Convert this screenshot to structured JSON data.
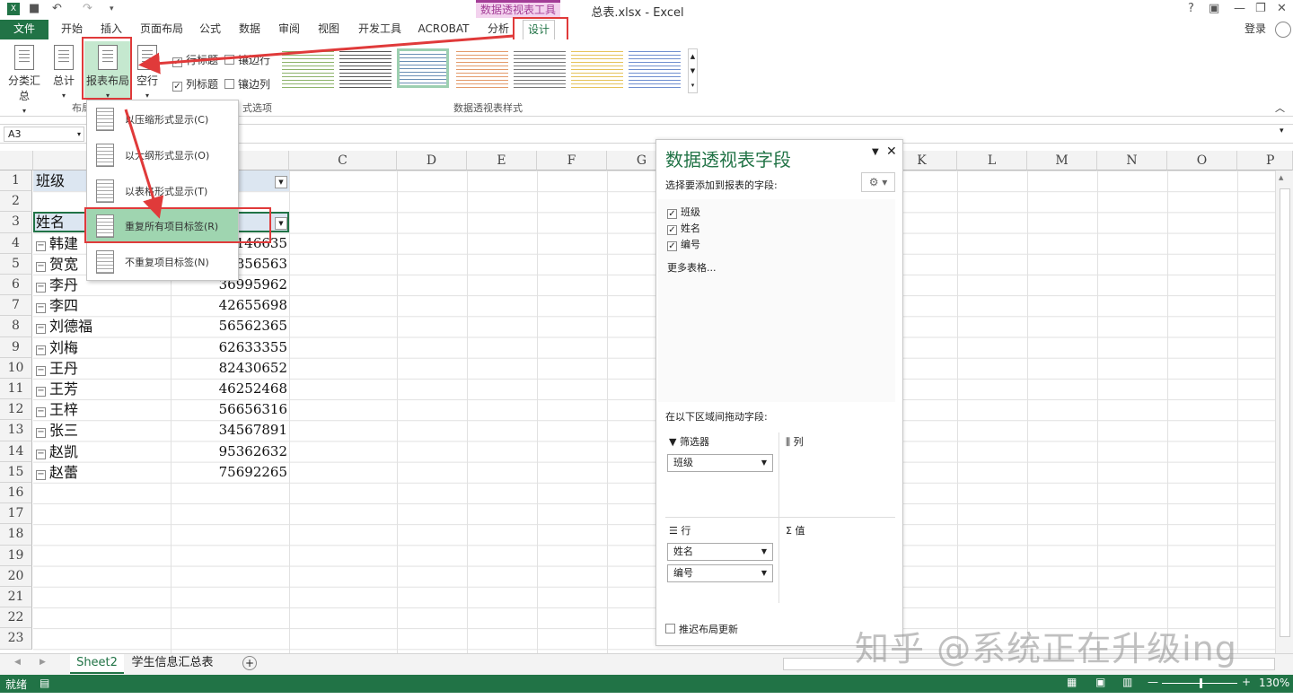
{
  "window": {
    "title": "总表.xlsx - Excel",
    "context_tool": "数据透视表工具",
    "login": "登录"
  },
  "tabs": [
    "文件",
    "开始",
    "插入",
    "页面布局",
    "公式",
    "数据",
    "审阅",
    "视图",
    "开发工具",
    "ACROBAT",
    "分析",
    "设计"
  ],
  "ribbon": {
    "subtotal": "分类汇总",
    "grandtotal": "总计",
    "report_layout": "报表布局",
    "blank_rows": "空行",
    "layout_group": "布局",
    "row_headers": "行标题",
    "banded_rows": "镶边行",
    "col_headers": "列标题",
    "banded_cols": "镶边列",
    "options_group": "数据透视表样式选项",
    "options_group_visible": "式选项",
    "styles_group": "数据透视表样式"
  },
  "formula_bar": {
    "name_box": "A3"
  },
  "dropdown": {
    "items": [
      "以压缩形式显示(C)",
      "以大纲形式显示(O)",
      "以表格形式显示(T)",
      "重复所有项目标签(R)",
      "不重复项目标签(N)"
    ],
    "highlighted_index": 3
  },
  "grid": {
    "columns_visible": [
      "C",
      "D",
      "E",
      "F",
      "G",
      "K",
      "L",
      "M",
      "N",
      "O",
      "P"
    ],
    "rows": [
      "1",
      "2",
      "3",
      "4",
      "5",
      "6",
      "7",
      "8",
      "9",
      "10",
      "11",
      "12",
      "13",
      "14",
      "15",
      "16",
      "17",
      "18",
      "19",
      "20",
      "21",
      "22",
      "23"
    ],
    "a1": "班级",
    "a3": "姓名",
    "data": [
      {
        "name": "韩建",
        "value": "146635"
      },
      {
        "name": "贺宽",
        "value": "856563"
      },
      {
        "name": "李丹",
        "value": "36995962"
      },
      {
        "name": "李四",
        "value": "42655698"
      },
      {
        "name": "刘德福",
        "value": "56562365"
      },
      {
        "name": "刘梅",
        "value": "62633355"
      },
      {
        "name": "王丹",
        "value": "82430652"
      },
      {
        "name": "王芳",
        "value": "46252468"
      },
      {
        "name": "王梓",
        "value": "56656316"
      },
      {
        "name": "张三",
        "value": "34567891"
      },
      {
        "name": "赵凯",
        "value": "95362632"
      },
      {
        "name": "赵蕾",
        "value": "75692265"
      }
    ]
  },
  "pane": {
    "title": "数据透视表字段",
    "subtitle": "选择要添加到报表的字段:",
    "fields": [
      "班级",
      "姓名",
      "编号"
    ],
    "more": "更多表格...",
    "drag_label": "在以下区域间拖动字段:",
    "filter_label": "筛选器",
    "filter_item": "班级",
    "col_label": "列",
    "row_label": "行",
    "row_items": [
      "姓名",
      "编号"
    ],
    "val_label": "值",
    "defer": "推迟布局更新"
  },
  "sheets": [
    "Sheet2",
    "学生信息汇总表"
  ],
  "status": {
    "ready": "就绪",
    "zoom": "130%"
  },
  "watermark": "知乎 @系统正在升级ing"
}
